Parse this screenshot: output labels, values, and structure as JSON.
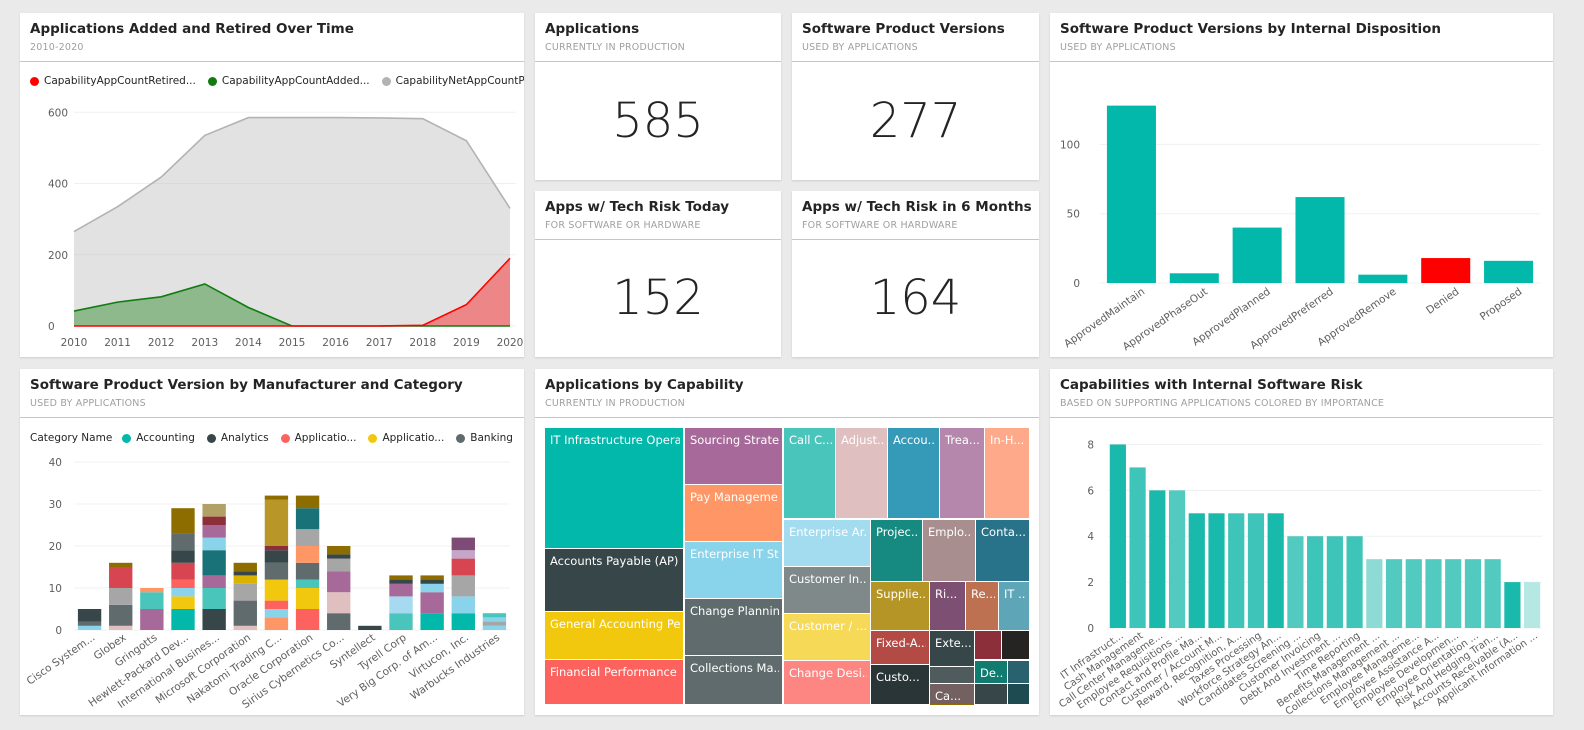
{
  "tiles": {
    "added_retired": {
      "title": "Applications Added and Retired Over Time",
      "sub": "2010-2020"
    },
    "applications": {
      "title": "Applications",
      "sub": "CURRENTLY IN PRODUCTION",
      "value": "585"
    },
    "versions": {
      "title": "Software Product Versions",
      "sub": "USED BY APPLICATIONS",
      "value": "277"
    },
    "disposition": {
      "title": "Software Product Versions by Internal Disposition",
      "sub": "USED BY APPLICATIONS"
    },
    "risk_today": {
      "title": "Apps w/ Tech Risk Today",
      "sub": "FOR SOFTWARE OR HARDWARE",
      "value": "152"
    },
    "risk_6m": {
      "title": "Apps w/ Tech Risk in 6 Months",
      "sub": "FOR SOFTWARE OR HARDWARE",
      "value": "164"
    },
    "manufacturer": {
      "title": "Software Product Version by Manufacturer and Category",
      "sub": "USED BY APPLICATIONS"
    },
    "capability": {
      "title": "Applications by Capability",
      "sub": "CURRENTLY IN PRODUCTION"
    },
    "cap_risk": {
      "title": "Capabilities with Internal Software Risk",
      "sub": "BASED ON SUPPORTING APPLICATIONS COLORED BY IMPORTANCE"
    }
  },
  "colors": {
    "teal": "#01b8aa",
    "dark": "#374649",
    "salmon": "#fd625e",
    "yellow": "#f2c80f",
    "grey": "#5f6b6d",
    "lightblue": "#8ad4eb",
    "orange": "#fe9666",
    "purple": "#a66999",
    "red": "#ff0000",
    "green": "#107c10",
    "silver": "#b3b3b3"
  },
  "chart_data": [
    {
      "id": "added_retired",
      "type": "area",
      "x": [
        2010,
        2011,
        2012,
        2013,
        2014,
        2015,
        2016,
        2017,
        2018,
        2019,
        2020
      ],
      "series": [
        {
          "name": "CapabilityAppCountRetired...",
          "color": "#ff0000",
          "values": [
            0,
            0,
            0,
            0,
            0,
            0,
            0,
            0,
            2,
            60,
            190
          ]
        },
        {
          "name": "CapabilityAppCountAdded...",
          "color": "#107c10",
          "values": [
            42,
            67,
            82,
            118,
            52,
            0,
            0,
            0,
            0,
            0,
            0
          ]
        },
        {
          "name": "CapabilityNetAppCountPro...",
          "color": "#b3b3b3",
          "values": [
            265,
            335,
            418,
            535,
            585,
            585,
            585,
            584,
            582,
            520,
            330
          ]
        }
      ],
      "yticks": [
        0,
        200,
        400,
        600
      ],
      "ylim": [
        0,
        640
      ]
    },
    {
      "id": "disposition",
      "type": "bar",
      "categories": [
        "ApprovedMaintain",
        "ApprovedPhaseOut",
        "ApprovedPlanned",
        "ApprovedPreferred",
        "ApprovedRemove",
        "Denied",
        "Proposed"
      ],
      "values": [
        128,
        7,
        40,
        62,
        6,
        18,
        16
      ],
      "colors": [
        "#01b8aa",
        "#01b8aa",
        "#01b8aa",
        "#01b8aa",
        "#01b8aa",
        "#ff0000",
        "#01b8aa"
      ],
      "yticks": [
        0,
        50,
        100
      ],
      "ylim": [
        0,
        140
      ]
    },
    {
      "id": "manufacturer",
      "type": "bar",
      "stacked": true,
      "legend_title": "Category Name",
      "legend": [
        {
          "name": "Accounting",
          "color": "#01b8aa"
        },
        {
          "name": "Analytics",
          "color": "#374649"
        },
        {
          "name": "Applicatio...",
          "color": "#fd625e"
        },
        {
          "name": "Applicatio...",
          "color": "#f2c80f"
        },
        {
          "name": "Banking",
          "color": "#5f6b6d"
        }
      ],
      "categories": [
        "Cisco System...",
        "Globex",
        "Gringotts",
        "Hewlett-Packard Dev...",
        "International Busines...",
        "Microsoft Corporation",
        "Nakatomi Trading C...",
        "Oracle Corporation",
        "Sirius Cybernetics Co...",
        "Syntellect",
        "Tyrell Corp",
        "Very Big Corp. of Am...",
        "Virtucon, Inc.",
        "Warbucks Industries"
      ],
      "totals": [
        5,
        16,
        10,
        29,
        30,
        16,
        28,
        34,
        20,
        1,
        13,
        13,
        22,
        4
      ],
      "segments": [
        [
          [
            "#8ad4eb",
            1
          ],
          [
            "#5f6b6d",
            1
          ],
          [
            "#374649",
            3
          ]
        ],
        [
          [
            "#dfbfbf",
            1
          ],
          [
            "#5f6b6d",
            5
          ],
          [
            "#a6a6a6",
            4
          ],
          [
            "#d64550",
            5
          ],
          [
            "#8d6d00",
            1
          ]
        ],
        [
          [
            "#a66999",
            5
          ],
          [
            "#4ac5bb",
            4
          ],
          [
            "#fe9666",
            1
          ]
        ],
        [
          [
            "#01b8aa",
            5
          ],
          [
            "#f2c80f",
            3
          ],
          [
            "#8ad4eb",
            2
          ],
          [
            "#fd625e",
            2
          ],
          [
            "#d64550",
            4
          ],
          [
            "#374649",
            3
          ],
          [
            "#5f6b6d",
            4
          ],
          [
            "#8d6d00",
            6
          ]
        ],
        [
          [
            "#374649",
            5
          ],
          [
            "#4ac5bb",
            5
          ],
          [
            "#a66999",
            3
          ],
          [
            "#197278",
            6
          ],
          [
            "#8ad4eb",
            3
          ],
          [
            "#a66999",
            3
          ],
          [
            "#8d2f3b",
            2
          ],
          [
            "#b3a064",
            3
          ]
        ],
        [
          [
            "#dfbfbf",
            1
          ],
          [
            "#5f6b6d",
            6
          ],
          [
            "#a6a6a6",
            4
          ],
          [
            "#d9b300",
            2
          ],
          [
            "#374649",
            1
          ],
          [
            "#8d6d00",
            2
          ]
        ],
        [
          [
            "#fe9666",
            3
          ],
          [
            "#8ad4eb",
            2
          ],
          [
            "#fd625e",
            2
          ],
          [
            "#f2c80f",
            5
          ],
          [
            "#5f6b6d",
            4
          ],
          [
            "#374649",
            3
          ],
          [
            "#8d2f3b",
            1
          ],
          [
            "#b89728",
            11
          ],
          [
            "#8d6d00",
            1
          ]
        ],
        [
          [
            "#fd625e",
            5
          ],
          [
            "#f2c80f",
            5
          ],
          [
            "#4ac5bb",
            2
          ],
          [
            "#5f6b6d",
            4
          ],
          [
            "#fe9666",
            4
          ],
          [
            "#a6a6a6",
            4
          ],
          [
            "#197278",
            5
          ],
          [
            "#8d6d00",
            3
          ]
        ],
        [
          [
            "#5f6b6d",
            4
          ],
          [
            "#dfbfbf",
            5
          ],
          [
            "#a66999",
            5
          ],
          [
            "#a6a6a6",
            3
          ],
          [
            "#374649",
            1
          ],
          [
            "#8d6d00",
            2
          ]
        ],
        [
          [
            "#374649",
            1
          ]
        ],
        [
          [
            "#4ac5bb",
            4
          ],
          [
            "#a6daf0",
            4
          ],
          [
            "#a66999",
            3
          ],
          [
            "#374649",
            1
          ],
          [
            "#8d6d00",
            1
          ]
        ],
        [
          [
            "#01b8aa",
            4
          ],
          [
            "#a66999",
            5
          ],
          [
            "#8ad4eb",
            2
          ],
          [
            "#374649",
            1
          ],
          [
            "#8d6d00",
            1
          ]
        ],
        [
          [
            "#01b8aa",
            4
          ],
          [
            "#8ad4eb",
            4
          ],
          [
            "#a6a6a6",
            5
          ],
          [
            "#d64550",
            4
          ],
          [
            "#c2a7c8",
            2
          ],
          [
            "#7e4a76",
            3
          ]
        ],
        [
          [
            "#8ad4eb",
            1
          ],
          [
            "#a6a6a6",
            1
          ],
          [
            "#8ad4eb",
            1
          ],
          [
            "#4ac5bb",
            1
          ]
        ]
      ],
      "yticks": [
        0,
        10,
        20,
        30,
        40
      ],
      "ylim": [
        0,
        40
      ]
    },
    {
      "id": "capability",
      "type": "treemap",
      "cells": [
        {
          "label": "IT Infrastructure Opera...",
          "color": "#01b8aa"
        },
        {
          "label": "Accounts Payable (AP) ...",
          "color": "#374649"
        },
        {
          "label": "General Accounting Pe...",
          "color": "#f2c80f"
        },
        {
          "label": "Financial Performance ...",
          "color": "#fd625e"
        },
        {
          "label": "Sourcing Strate...",
          "color": "#a66999"
        },
        {
          "label": "Pay Manageme...",
          "color": "#fe9666"
        },
        {
          "label": "Enterprise IT St...",
          "color": "#8ad4eb"
        },
        {
          "label": "Change Planning",
          "color": "#5f6b6d"
        },
        {
          "label": "Collections Ma...",
          "color": "#5f6b6d"
        },
        {
          "label": "Call C...",
          "color": "#4ac5bb"
        },
        {
          "label": "Adjust...",
          "color": "#dfbfbf"
        },
        {
          "label": "Accou...",
          "color": "#3599b8"
        },
        {
          "label": "Trea...",
          "color": "#b687ac"
        },
        {
          "label": "In-H...",
          "color": "#fea98a"
        },
        {
          "label": "Enterprise Ar...",
          "color": "#a2dcee"
        },
        {
          "label": "Customer In...",
          "color": "#7f898a"
        },
        {
          "label": "Customer / ...",
          "color": "#f6d956"
        },
        {
          "label": "Change Desi...",
          "color": "#fd8682"
        },
        {
          "label": "Projec...",
          "color": "#168980"
        },
        {
          "label": "Emplo...",
          "color": "#a88e8e"
        },
        {
          "label": "Conta...",
          "color": "#28738a"
        },
        {
          "label": "Supplie...",
          "color": "#b59525"
        },
        {
          "label": "Ri...",
          "color": "#7c4f73"
        },
        {
          "label": "Re...",
          "color": "#bd7150"
        },
        {
          "label": "IT ...",
          "color": "#5fa5b8"
        },
        {
          "label": "Fixed-A...",
          "color": "#b44a46"
        },
        {
          "label": "Exte...",
          "color": "#374649"
        },
        {
          "label": "Custo...",
          "color": "#293537"
        },
        {
          "label": "De...",
          "color": "#107c70"
        },
        {
          "label": "Ca...",
          "color": "#736060"
        },
        {
          "label": "",
          "color": "#8d2f3b"
        },
        {
          "label": "",
          "color": "#252423"
        },
        {
          "label": "",
          "color": "#4f5b5c"
        },
        {
          "label": "",
          "color": "#29626e"
        },
        {
          "label": "",
          "color": "#374649"
        },
        {
          "label": "",
          "color": "#8d6d00"
        },
        {
          "label": "",
          "color": "#1e4a52"
        }
      ]
    },
    {
      "id": "cap_risk",
      "type": "bar",
      "categories": [
        "IT Infrastruct...",
        "Cash Management",
        "Call Center Manageme...",
        "Employee Requisitions ...",
        "Contact and Profile Ma...",
        "Customer / Account M...",
        "Reward, Recognition, A...",
        "Taxes Processing",
        "Workforce Strategy An...",
        "Candidates Screening ...",
        "Customer Invoicing",
        "Debt And Investment ...",
        "Time Reporting",
        "Benefits Management ...",
        "Collections Management ...",
        "Employee Manageme...",
        "Employee Assistance A...",
        "Employee Developmen...",
        "Employee Orientation ...",
        "Risk And Hedging Tran...",
        "Accounts Receivable (A...",
        "Applicant Information ..."
      ],
      "values": [
        8,
        7,
        6,
        6,
        5,
        5,
        5,
        5,
        5,
        4,
        4,
        4,
        4,
        3,
        3,
        3,
        3,
        3,
        3,
        3,
        2,
        2
      ],
      "colors": [
        "#19b9ab",
        "#3ec4b8",
        "#19b9ab",
        "#52cabf",
        "#19b9ab",
        "#19b9ab",
        "#3ec4b8",
        "#3ec4b8",
        "#19b9ab",
        "#52cabf",
        "#3ec4b8",
        "#3ec4b8",
        "#3ec4b8",
        "#8ddbd4",
        "#52cabf",
        "#52cabf",
        "#52cabf",
        "#52cabf",
        "#52cabf",
        "#52cabf",
        "#19b9ab",
        "#b5e8e3"
      ],
      "yticks": [
        0,
        2,
        4,
        6,
        8
      ],
      "ylim": [
        0,
        8.5
      ]
    }
  ]
}
